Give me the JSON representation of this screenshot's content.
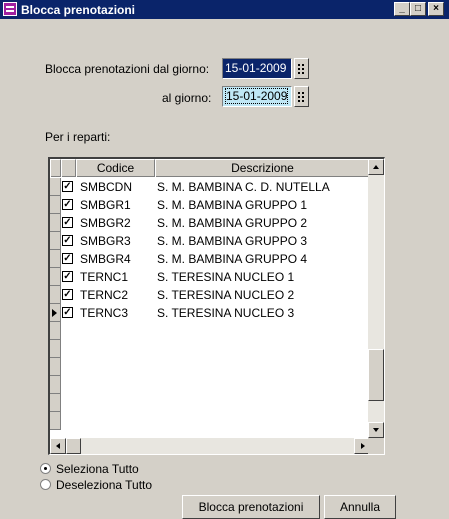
{
  "window": {
    "title": "Blocca prenotazioni",
    "controls": {
      "minimize": "_",
      "maximize": "□",
      "close": "×"
    }
  },
  "filters": {
    "from_label": "Blocca prenotazioni dal giorno:",
    "from_value": "15-01-2009",
    "to_label": "al giorno:",
    "to_value": "15-01-2009"
  },
  "departments": {
    "label": "Per i reparti:",
    "columns": {
      "code": "Codice",
      "description": "Descrizione"
    },
    "rows": [
      {
        "checked": "✓",
        "code": "SMBCDN",
        "description": "S. M. BAMBINA C. D. NUTELLA"
      },
      {
        "checked": "✓",
        "code": "SMBGR1",
        "description": "S. M. BAMBINA GRUPPO 1"
      },
      {
        "checked": "✓",
        "code": "SMBGR2",
        "description": "S. M. BAMBINA GRUPPO 2"
      },
      {
        "checked": "✓",
        "code": "SMBGR3",
        "description": "S. M. BAMBINA GRUPPO 3"
      },
      {
        "checked": "✓",
        "code": "SMBGR4",
        "description": "S. M. BAMBINA GRUPPO 4"
      },
      {
        "checked": "✓",
        "code": "TERNC1",
        "description": "S. TERESINA NUCLEO 1"
      },
      {
        "checked": "✓",
        "code": "TERNC2",
        "description": "S. TERESINA NUCLEO 2"
      },
      {
        "checked": "✓",
        "code": "TERNC3",
        "description": "S. TERESINA NUCLEO 3"
      }
    ]
  },
  "selection": {
    "select_all": "Seleziona Tutto",
    "deselect_all": "Deseleziona Tutto",
    "selected": "select_all"
  },
  "buttons": {
    "block": "Blocca prenotazioni",
    "cancel": "Annulla"
  }
}
